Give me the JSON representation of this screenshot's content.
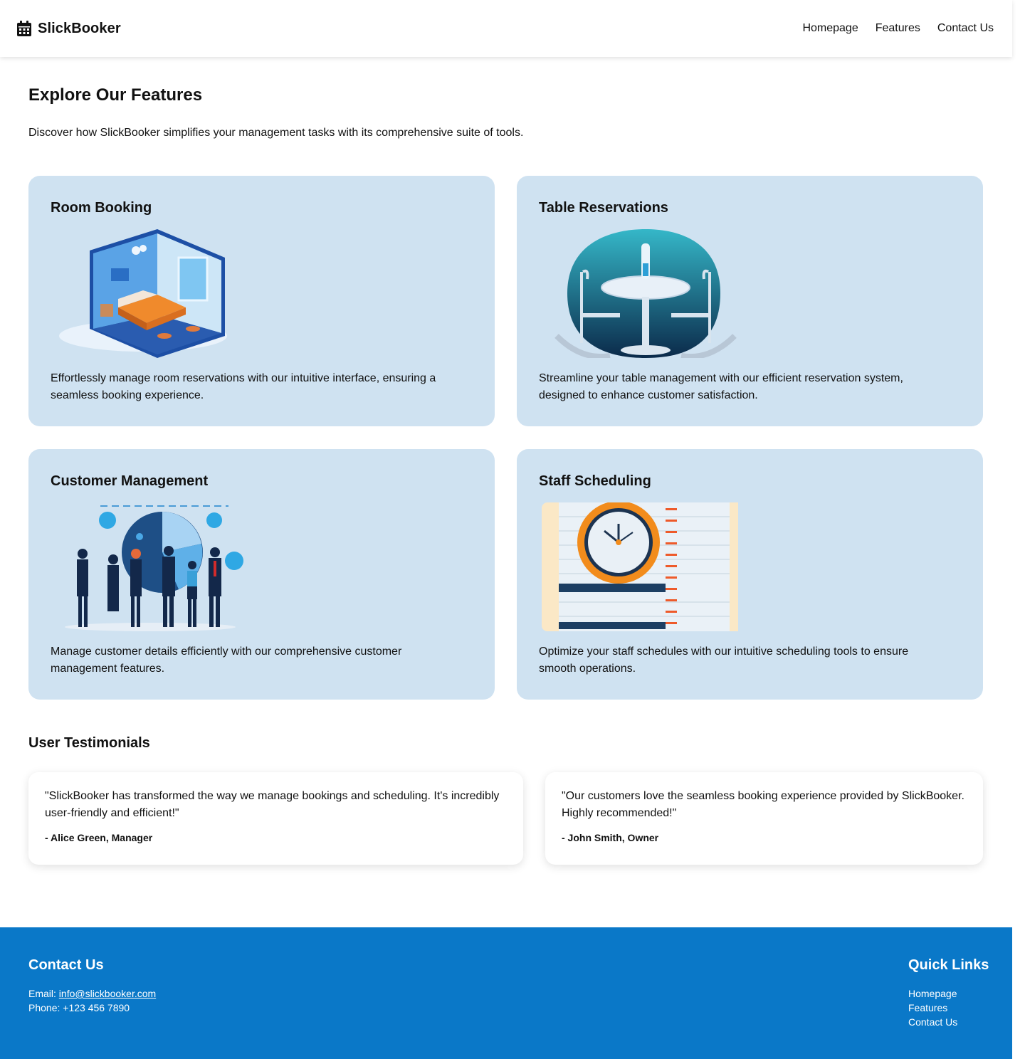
{
  "header": {
    "brand": "SlickBooker",
    "nav": [
      "Homepage",
      "Features",
      "Contact Us"
    ]
  },
  "intro": {
    "title": "Explore Our Features",
    "text": "Discover how SlickBooker simplifies your management tasks with its comprehensive suite of tools."
  },
  "features": [
    {
      "title": "Room Booking",
      "text": "Effortlessly manage room reservations with our intuitive interface, ensuring a seamless booking experience.",
      "icon": "isometric-room-illustration"
    },
    {
      "title": "Table Reservations",
      "text": "Streamline your table management with our efficient reservation system, designed to enhance customer satisfaction.",
      "icon": "table-chairs-illustration"
    },
    {
      "title": "Customer Management",
      "text": "Manage customer details efficiently with our comprehensive customer management features.",
      "icon": "business-team-chart-illustration"
    },
    {
      "title": "Staff Scheduling",
      "text": "Optimize your staff schedules with our intuitive scheduling tools to ensure smooth operations.",
      "icon": "clock-schedule-illustration"
    }
  ],
  "testimonials": {
    "title": "User Testimonials",
    "items": [
      {
        "quote": "\"SlickBooker has transformed the way we manage bookings and scheduling. It's incredibly user-friendly and efficient!\"",
        "author": "- Alice Green, Manager"
      },
      {
        "quote": "\"Our customers love the seamless booking experience provided by SlickBooker. Highly recommended!\"",
        "author": "- John Smith, Owner"
      }
    ]
  },
  "footer": {
    "contact_title": "Contact Us",
    "email_label": "Email: ",
    "email": "info@slickbooker.com",
    "phone": "Phone: +123 456 7890",
    "links_title": "Quick Links",
    "links": [
      "Homepage",
      "Features",
      "Contact Us"
    ]
  },
  "colors": {
    "card_bg": "#cfe2f1",
    "footer_bg": "#0a78c8"
  }
}
